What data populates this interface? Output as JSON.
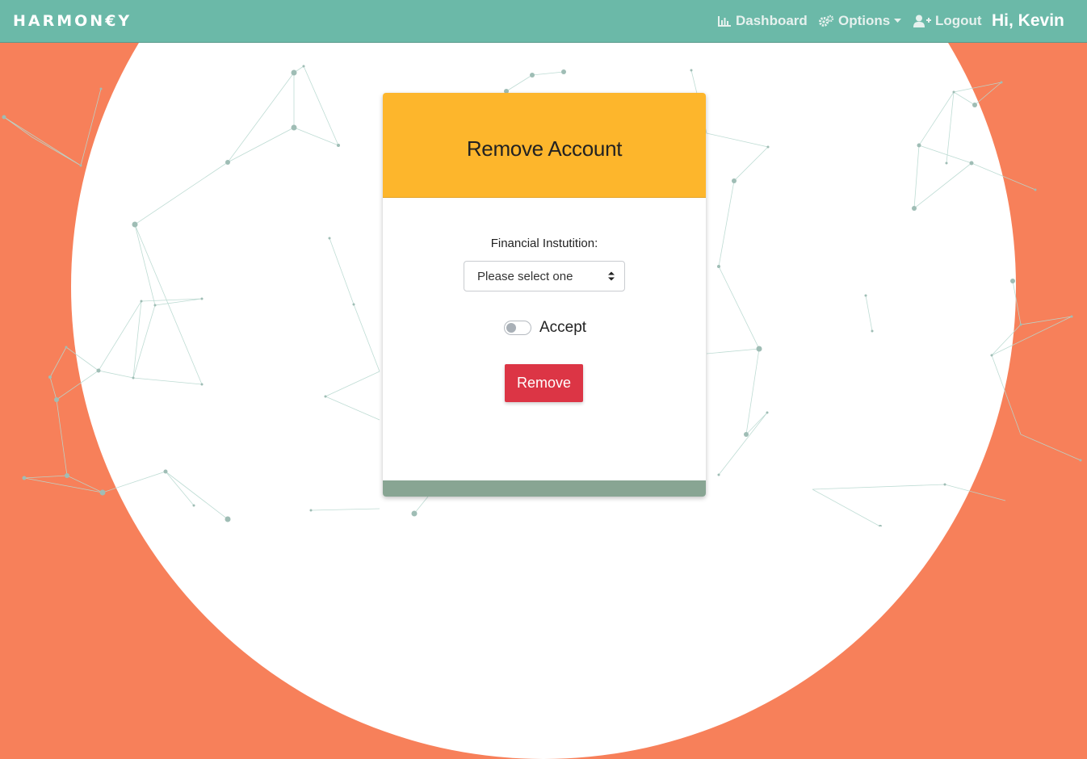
{
  "navbar": {
    "brand": "HARMON€Y",
    "dashboard_label": "Dashboard",
    "options_label": "Options",
    "logout_label": "Logout",
    "greeting": "Hi, Kevin"
  },
  "card": {
    "title": "Remove Account",
    "institution_label": "Financial Instutition:",
    "institution_select_value": "Please select one",
    "accept_label": "Accept",
    "accept_checked": false,
    "remove_button": "Remove"
  },
  "colors": {
    "navbar": "#6bb9a8",
    "background": "#f7805a",
    "card_header": "#fdb62c",
    "remove_button": "#dc3545",
    "card_footer": "#88a593"
  }
}
